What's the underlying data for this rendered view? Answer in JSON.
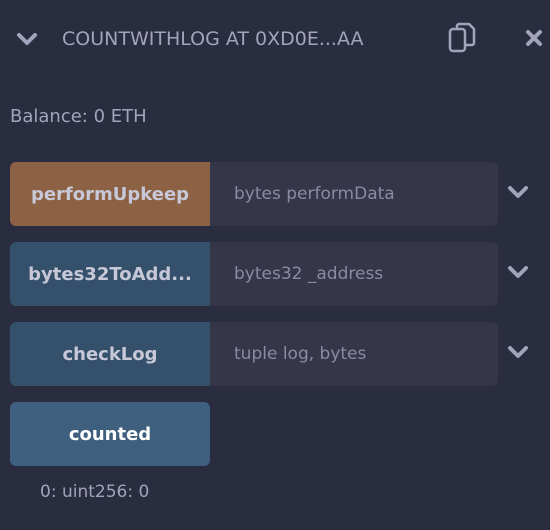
{
  "header": {
    "title": "COUNTWITHLOG AT 0XD0E...AA",
    "icons": [
      "chevron-down-icon",
      "copy-icon",
      "close-icon"
    ]
  },
  "balance": "Balance: 0 ETH",
  "functions": [
    {
      "label": "performUpkeep",
      "placeholder": "bytes performData",
      "color": "#8c6144"
    },
    {
      "label": "bytes32ToAdd...",
      "placeholder": "bytes32 _address",
      "color": "#35506a"
    },
    {
      "label": "checkLog",
      "placeholder": "tuple log, bytes",
      "color": "#35506a"
    },
    {
      "label": "counted",
      "color": "#3f5f7e"
    }
  ],
  "output": "0: uint256: 0"
}
